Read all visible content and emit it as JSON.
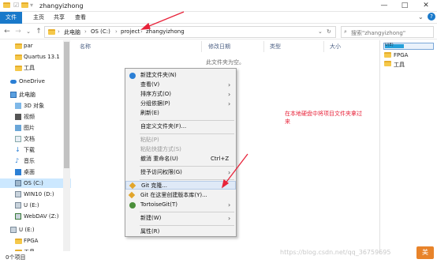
{
  "window": {
    "title": "zhangyizhong",
    "minimize": "—",
    "maximize": "□",
    "close": "✕"
  },
  "ribbon": {
    "tabs": [
      "文件",
      "主页",
      "共享",
      "查看"
    ]
  },
  "address": {
    "crumbs": [
      "此电脑",
      "OS (C:)",
      "project",
      "zhangyizhong"
    ],
    "search_placeholder": "搜索\"zhangyizhong\""
  },
  "nav": {
    "items": [
      {
        "label": "par",
        "icon": "folder-icon"
      },
      {
        "label": "Quartus 13.1",
        "icon": "folder-icon"
      },
      {
        "label": "工具",
        "icon": "folder-icon"
      },
      {
        "label": "OneDrive",
        "icon": "onedrive-icon"
      },
      {
        "label": "此电脑",
        "icon": "computer-icon"
      },
      {
        "label": "3D 对象",
        "icon": "3d-objects-icon"
      },
      {
        "label": "视频",
        "icon": "video-icon"
      },
      {
        "label": "图片",
        "icon": "pictures-icon"
      },
      {
        "label": "文档",
        "icon": "documents-icon"
      },
      {
        "label": "下载",
        "icon": "download-icon"
      },
      {
        "label": "音乐",
        "icon": "music-icon"
      },
      {
        "label": "桌面",
        "icon": "desktop-icon"
      },
      {
        "label": "OS (C:)",
        "icon": "drive-icon"
      },
      {
        "label": "WIN10 (D:)",
        "icon": "drive-icon"
      },
      {
        "label": "U (E:)",
        "icon": "drive-icon"
      },
      {
        "label": "WebDAV (Z:)",
        "icon": "network-drive-icon"
      },
      {
        "label": "U (E:)",
        "icon": "usb-drive-icon"
      },
      {
        "label": "FPGA",
        "icon": "folder-icon"
      },
      {
        "label": "工具",
        "icon": "folder-icon"
      }
    ]
  },
  "columns": [
    "名称",
    "修改日期",
    "类型",
    "大小"
  ],
  "empty_text": "此文件夹为空。",
  "right_panel": {
    "drive_label": "U(E)",
    "items": [
      "FPGA",
      "工具"
    ]
  },
  "status": {
    "count": "0个项目"
  },
  "context_menu": {
    "items": [
      {
        "label": "新建文件夹(N)",
        "icon": "new-folder-icon"
      },
      {
        "label": "查看(V)",
        "arrow": "›"
      },
      {
        "label": "排序方式(O)",
        "arrow": "›"
      },
      {
        "label": "分组依据(P)",
        "arrow": "›"
      },
      {
        "label": "刷新(E)"
      },
      {
        "label": "自定义文件夹(F)..."
      },
      {
        "label": "粘贴(P)",
        "disabled": true
      },
      {
        "label": "粘贴快捷方式(S)",
        "disabled": true
      },
      {
        "label": "撤消 重命名(U)",
        "shortcut": "Ctrl+Z"
      },
      {
        "label": "授予访问权限(G)",
        "arrow": "›"
      },
      {
        "label": "Git 克隆...",
        "icon": "git-icon"
      },
      {
        "label": "Git 在这里创建版本库(Y)...",
        "icon": "git-icon"
      },
      {
        "label": "TortoiseGit(T)",
        "icon": "tortoisegit-icon",
        "arrow": "›"
      },
      {
        "label": "新建(W)",
        "arrow": "›"
      },
      {
        "label": "属性(R)"
      }
    ]
  },
  "annotation": "在本地硬盘中将项目文件夹拿过来",
  "watermark": "https://blog.csdn.net/qq_36759695"
}
